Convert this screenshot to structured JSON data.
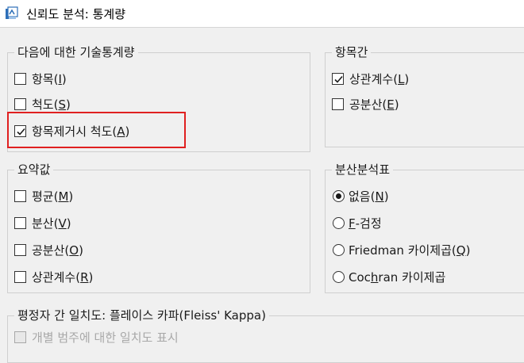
{
  "window": {
    "title": "신뢰도 분석: 통계량"
  },
  "descriptives": {
    "legend": "다음에 대한 기술통계량",
    "items": [
      {
        "pre": "항목(",
        "key": "I",
        "post": ")",
        "checked": false
      },
      {
        "pre": "척도(",
        "key": "S",
        "post": ")",
        "checked": false
      },
      {
        "pre": "항목제거시 척도(",
        "key": "A",
        "post": ")",
        "checked": true
      }
    ]
  },
  "inter_item": {
    "legend": "항목간",
    "items": [
      {
        "pre": "상관계수(",
        "key": "L",
        "post": ")",
        "checked": true
      },
      {
        "pre": "공분산(",
        "key": "E",
        "post": ")",
        "checked": false
      }
    ]
  },
  "summaries": {
    "legend": "요약값",
    "items": [
      {
        "pre": "평균(",
        "key": "M",
        "post": ")",
        "checked": false
      },
      {
        "pre": "분산(",
        "key": "V",
        "post": ")",
        "checked": false
      },
      {
        "pre": "공분산(",
        "key": "O",
        "post": ")",
        "checked": false
      },
      {
        "pre": "상관계수(",
        "key": "R",
        "post": ")",
        "checked": false
      }
    ]
  },
  "anova": {
    "legend": "분산분석표",
    "items": [
      {
        "pre": "없음(",
        "key": "N",
        "post": ")",
        "selected": true
      },
      {
        "pre": "",
        "key": "F",
        "post": "-검정",
        "selected": false
      },
      {
        "pre": "Friedman 카이제곱(",
        "key": "Q",
        "post": ")",
        "selected": false
      },
      {
        "pre": "Coc",
        "key": "h",
        "post": "ran 카이제곱",
        "selected": false
      }
    ]
  },
  "interrater": {
    "legend": "평정자 간 일치도: 플레이스 카파(Fleiss' Kappa)",
    "partial_item": "개별 범주에 대한 일치도 표시"
  },
  "colors": {
    "highlight": "#e02020",
    "background": "#f0f0f0",
    "title_bar": "#ffffff"
  },
  "icons": {
    "app": "spss-reliability-icon",
    "check": "checkmark-icon"
  }
}
